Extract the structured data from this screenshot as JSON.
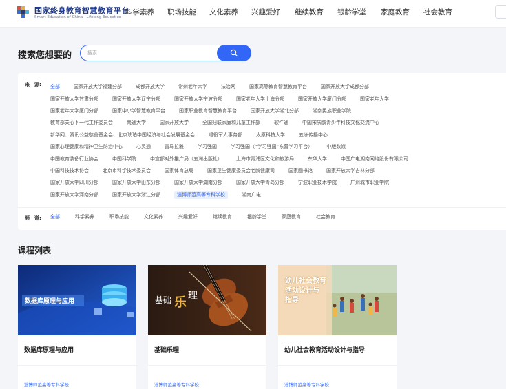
{
  "header": {
    "title": "国家终身教育智慧教育平台",
    "subtitle": "Smart Education of China · Lifelong Education",
    "nav": [
      "科学素养",
      "职场技能",
      "文化素养",
      "兴趣爱好",
      "继续教育",
      "银龄学堂",
      "家庭教育",
      "社会教育"
    ]
  },
  "search": {
    "title": "搜索您想要的",
    "placeholder": "搜索"
  },
  "filters": {
    "source_label": "来　源:",
    "channel_label": "频　道:",
    "source_rows": [
      [
        "全部",
        "国家开放大学福建分部",
        "成都开放大学",
        "常州老年大学",
        "法治网",
        "国家高等教育智慧教育平台",
        "国家开放大学成都分部"
      ],
      [
        "国家开放大学甘肃分部",
        "国家开放大学辽宁分部",
        "国家开放大学宁波分部",
        "国家老年大学上海分部",
        "国家开放大学厦门分部",
        "国家老年大学"
      ],
      [
        "国家老年大学厦门分部",
        "国家中小学智慧教育平台",
        "国家职业教育智慧教育平台",
        "国家开放大学湖北分部",
        "湖南民族职业学院"
      ],
      [
        "教育部关心下一代工作委员会",
        "南通大学",
        "国家开放大学",
        "全国妇联家庭和儿童工作部",
        "软件通",
        "中国宋庆龄青少年科技文化交流中心"
      ],
      [
        "新华网、腾讯公益慈善基金会、北京琥珀中国经济与社会发展基金会",
        "退役军人事务部",
        "太原科技大学",
        "五洲传播中心"
      ],
      [
        "国家心理健康和精神卫生防治中心",
        "心灵通",
        "喜马拉雅",
        "学习强国",
        "学习强国（“学习强国”东营学习平台）",
        "中版数媒"
      ],
      [
        "中国教育装备行业协会",
        "中国科学院",
        "中宣部对外推广局（五洲出版社）",
        "上海市青浦区文化和旅游局",
        "东华大学",
        "中国广电湖南网络股份有限公司"
      ],
      [
        "中国科技技术协会",
        "北京市科学技术委员会",
        "国家体育总局",
        "国家卫生健康委员会老龄健康司",
        "国家图书馆",
        "国家开放大学吉林分部"
      ],
      [
        "国家开放大学四川分部",
        "国家开放大学山东分部",
        "国家开放大学湖南分部",
        "国家开放大学青岛分部",
        "宁波职业技术学院",
        "广州城市职业学院"
      ],
      [
        "国家开放大学河南分部",
        "国家开放大学浙江分部",
        "淄博师范高等专科学校",
        "湖南广电"
      ]
    ],
    "channels": [
      "全部",
      "科学素养",
      "职场技能",
      "文化素养",
      "兴趣爱好",
      "继续教育",
      "银龄学堂",
      "家庭教育",
      "社会教育"
    ]
  },
  "courses": {
    "title": "课程列表",
    "items": [
      {
        "name": "数据库原理与应用",
        "org": "淄博师范高等专科学校",
        "image_text": "数据库原理与应用"
      },
      {
        "name": "基础乐理",
        "org": "淄博师范高等专科学校",
        "image_text_a": "基础",
        "image_text_b": "乐",
        "image_text_c": "理"
      },
      {
        "name": "幼儿社会教育活动设计与指导",
        "org": "淄博师范高等专科学校",
        "image_text_lines": [
          "幼儿社会教育",
          "活动设计与",
          "指导"
        ]
      }
    ]
  },
  "colors": {
    "accent": "#3266f6",
    "brand_dark": "#1f3a8a"
  }
}
